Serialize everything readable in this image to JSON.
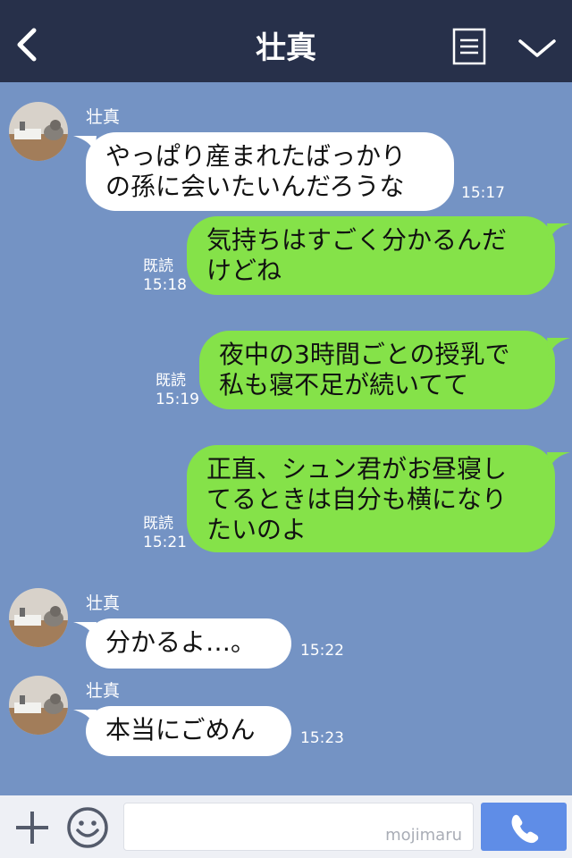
{
  "header": {
    "title": "壮真"
  },
  "messages": [
    {
      "sender": "壮真",
      "lines": [
        "やっぱり産まれたばっかり",
        "の孫に会いたいんだろうな"
      ],
      "time": "15:17"
    },
    {
      "lines": [
        "気持ちはすごく分かるんだ",
        "けどね"
      ],
      "read": "既読",
      "time": "15:18"
    },
    {
      "lines": [
        "夜中の3時間ごとの授乳で",
        "私も寝不足が続いてて"
      ],
      "read": "既読",
      "time": "15:19"
    },
    {
      "lines": [
        "正直、シュン君がお昼寝し",
        "てるときは自分も横になり",
        "たいのよ"
      ],
      "read": "既読",
      "time": "15:21"
    },
    {
      "sender": "壮真",
      "lines": [
        "分かるよ…。"
      ],
      "time": "15:22"
    },
    {
      "sender": "壮真",
      "lines": [
        "本当にごめん"
      ],
      "time": "15:23"
    }
  ],
  "input": {
    "watermark": "mojimaru"
  },
  "icons": {
    "back": "chevron-left-icon",
    "menu": "notes-icon",
    "collapse": "chevron-down-icon",
    "plus": "plus-icon",
    "emoji": "smiley-icon",
    "call": "phone-icon",
    "avatar": "cat-photo-avatar"
  },
  "colors": {
    "header_bg": "#27304a",
    "chat_bg": "#7493c4",
    "outgoing_bubble": "#85e249",
    "incoming_bubble": "#ffffff",
    "call_button": "#5f8de7"
  }
}
